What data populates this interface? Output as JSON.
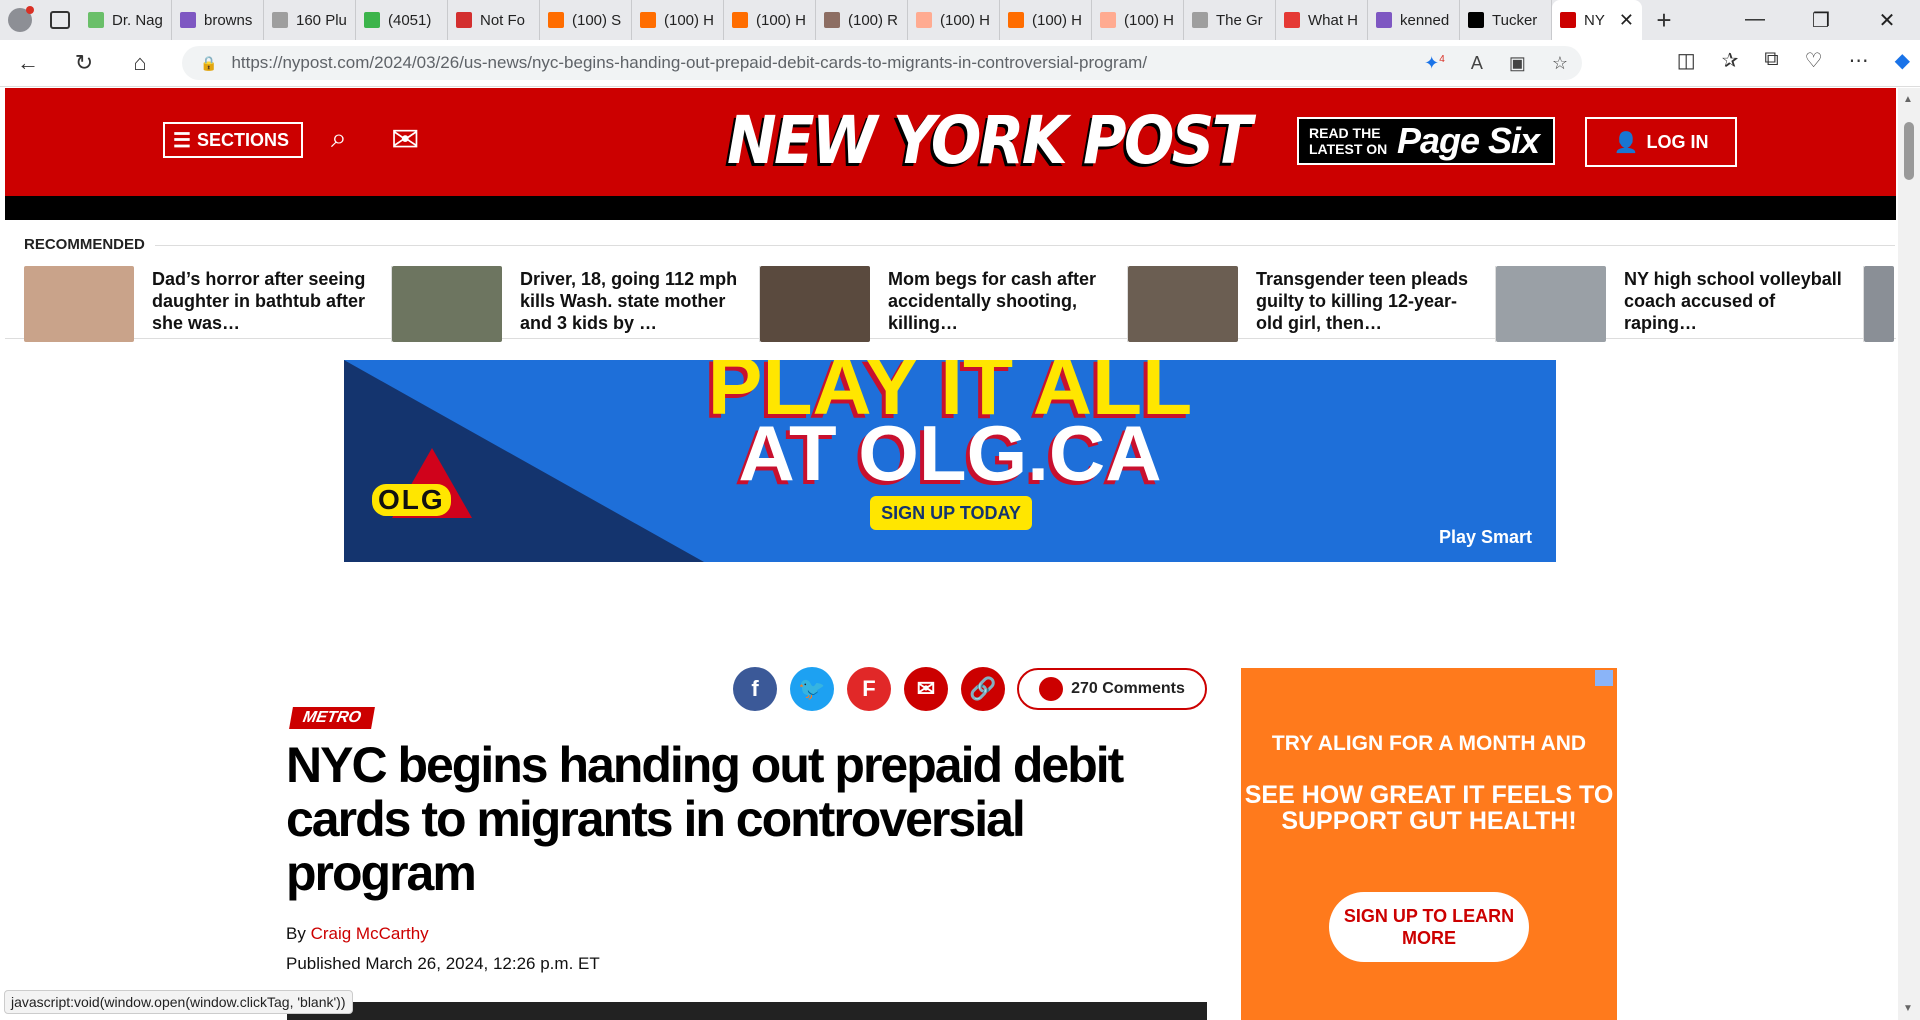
{
  "browser": {
    "tabs": [
      {
        "label": "Dr. Nag",
        "fav": "#6abf69"
      },
      {
        "label": "browns",
        "fav": "#7e57c2"
      },
      {
        "label": "160 Plu",
        "fav": "#9e9e9e"
      },
      {
        "label": "(4051)",
        "fav": "#3cb44b"
      },
      {
        "label": "Not Fo",
        "fav": "#d32f2f"
      },
      {
        "label": "(100) S",
        "fav": "#ff6d00"
      },
      {
        "label": "(100) H",
        "fav": "#ff6d00"
      },
      {
        "label": "(100) H",
        "fav": "#ff6d00"
      },
      {
        "label": "(100) R",
        "fav": "#8d6e63"
      },
      {
        "label": "(100) H",
        "fav": "#ffab91"
      },
      {
        "label": "(100) H",
        "fav": "#ff6d00"
      },
      {
        "label": "(100) H",
        "fav": "#ffab91"
      },
      {
        "label": "The Gr",
        "fav": "#9e9e9e"
      },
      {
        "label": "What H",
        "fav": "#e53935"
      },
      {
        "label": "kenned",
        "fav": "#7e57c2"
      },
      {
        "label": "Tucker",
        "fav": "#000000"
      }
    ],
    "active_tab": {
      "label": "NY",
      "close": "✕"
    },
    "new_tab": "+",
    "url": "https://nypost.com/2024/03/26/us-news/nyc-begins-handing-out-prepaid-debit-cards-to-migrants-in-controversial-program/",
    "badge_count": "4"
  },
  "header": {
    "sections_label": "SECTIONS",
    "logo": "NEW YORK POST",
    "pagesix_small": "READ THE LATEST ON",
    "pagesix_big": "Page Six",
    "login_label": "LOG IN"
  },
  "recommended": {
    "label": "RECOMMENDED",
    "items": [
      {
        "title": "Dad’s horror after seeing daughter in bathtub after she was…",
        "thumb": "#c9a38a"
      },
      {
        "title": "Driver, 18, going 112 mph kills Wash. state mother and 3 kids by …",
        "thumb": "#6d7560"
      },
      {
        "title": "Mom begs for cash after accidentally shooting, killing…",
        "thumb": "#5a4a3e"
      },
      {
        "title": "Transgender teen pleads guilty to killing 12-year-old girl, then…",
        "thumb": "#6b5e52"
      },
      {
        "title": "NY high school volleyball coach accused of raping…",
        "thumb": "#9aa0a6"
      }
    ]
  },
  "ad_banner": {
    "line1": "PLAY IT ALL",
    "line2": "AT OLG.CA",
    "cta": "SIGN UP TODAY",
    "brand": "OLG",
    "footer": "Play Smart"
  },
  "share": {
    "comments": "270 Comments"
  },
  "article": {
    "category": "METRO",
    "headline": "NYC begins handing out prepaid debit cards to migrants in controversial program",
    "by_prefix": "By",
    "author": "Craig McCarthy",
    "published": "Published March 26, 2024, 12:26 p.m. ET"
  },
  "side_ad": {
    "line1": "TRY ALIGN FOR A MONTH AND",
    "line2": "SEE HOW GREAT IT FEELS TO SUPPORT GUT HEALTH!",
    "cta": "SIGN UP TO LEARN MORE"
  },
  "status_bar": "javascript:void(window.open(window.clickTag, 'blank'))"
}
